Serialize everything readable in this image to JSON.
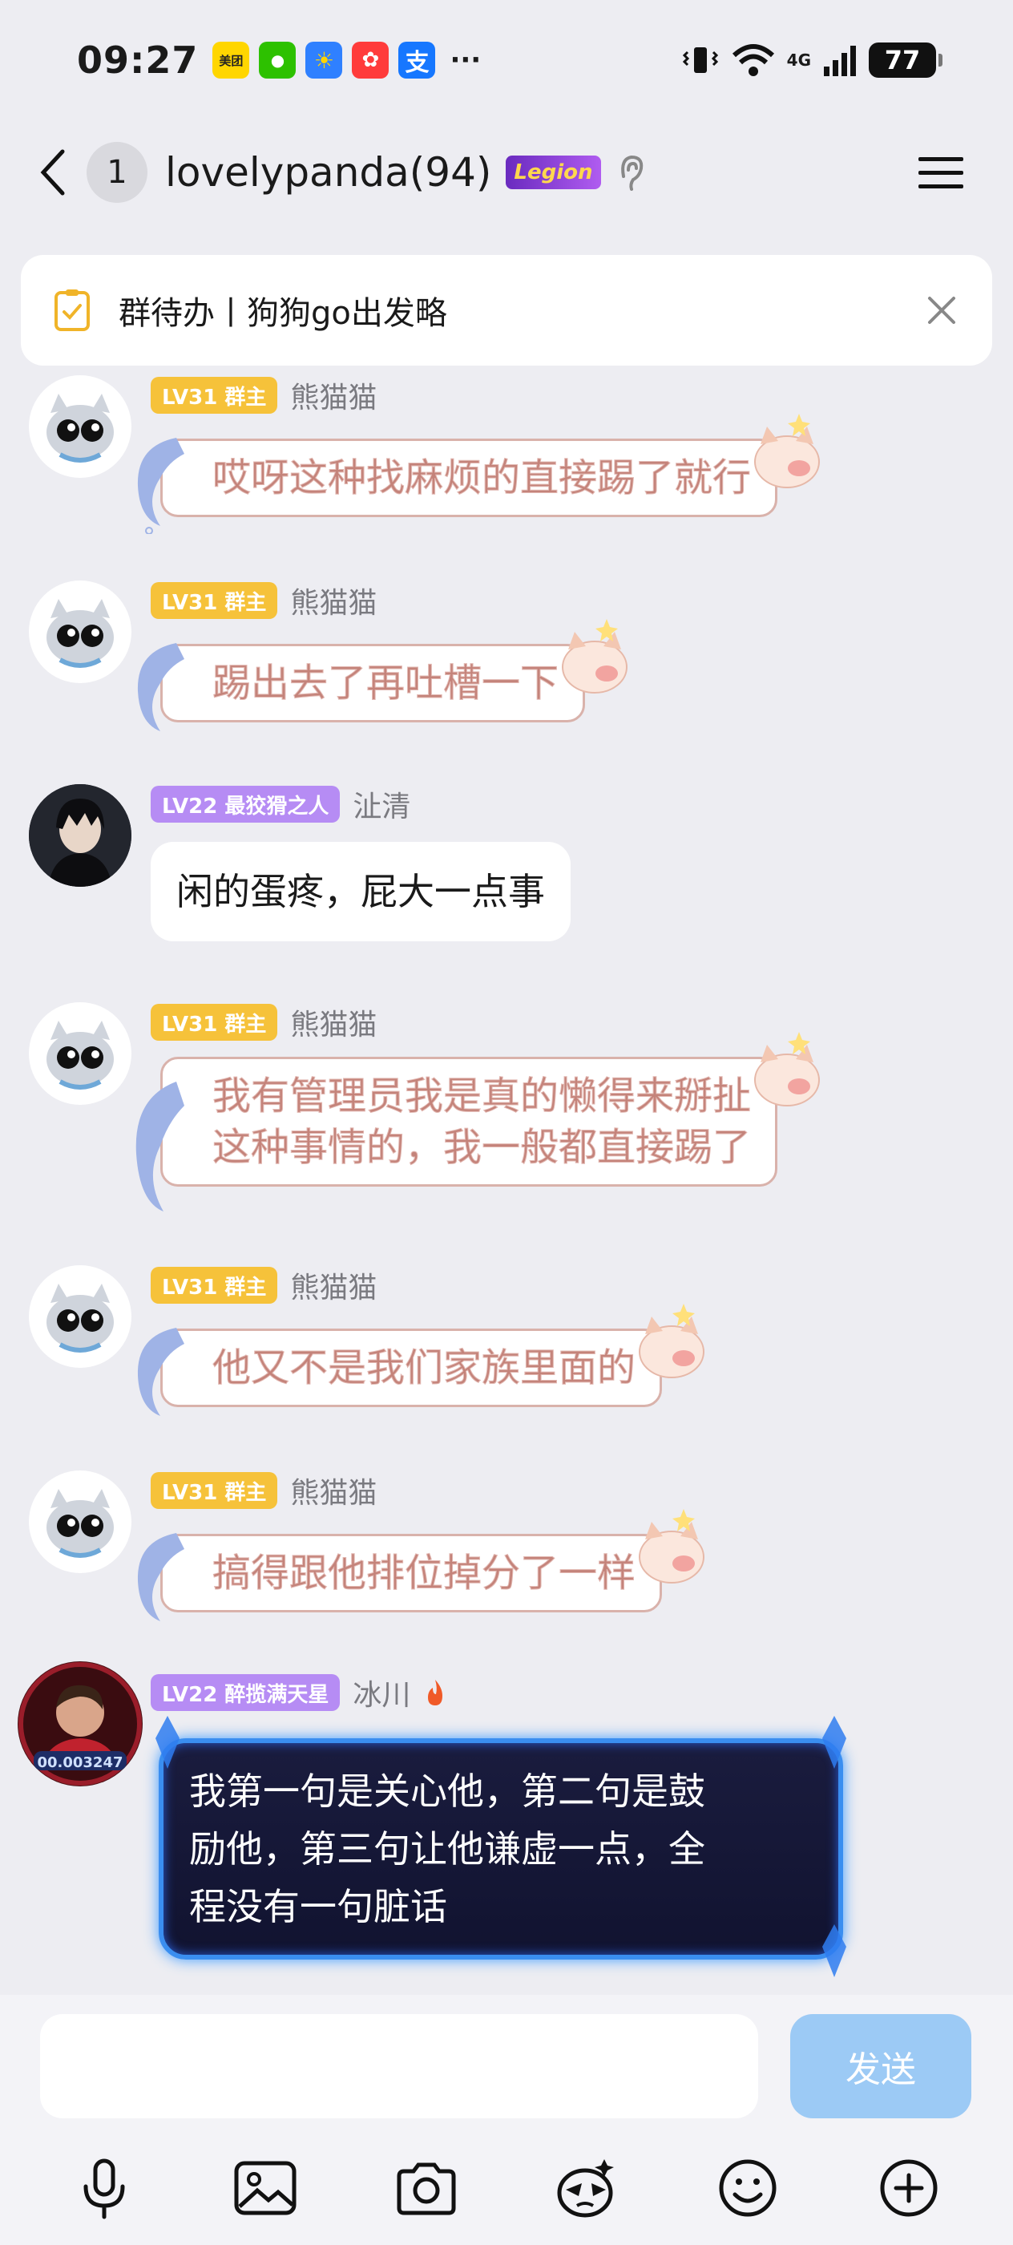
{
  "status_bar": {
    "time": "09:27",
    "notif_meituan": "美团",
    "notif_alipay": "支",
    "more": "···",
    "network": "4G",
    "battery": "77"
  },
  "nav": {
    "unread_count": "1",
    "title": "lovelypanda(94)",
    "legion_badge": "Legion"
  },
  "todo_banner": {
    "text": "群待办丨狗狗go出发略"
  },
  "messages": [
    {
      "level": "LV31 群主",
      "sender": "熊猫猫",
      "text": "哎呀这种找麻烦的直接踢了就行"
    },
    {
      "level": "LV31 群主",
      "sender": "熊猫猫",
      "text": "踢出去了再吐槽一下"
    },
    {
      "level": "LV22 最狡猾之人",
      "sender": "沚清",
      "text": "闲的蛋疼，屁大一点事"
    },
    {
      "level": "LV31 群主",
      "sender": "熊猫猫",
      "text_line1": "我有管理员我是真的懒得来掰扯",
      "text_line2": "这种事情的，我一般都直接踢了"
    },
    {
      "level": "LV31 群主",
      "sender": "熊猫猫",
      "text": "他又不是我们家族里面的"
    },
    {
      "level": "LV31 群主",
      "sender": "熊猫猫",
      "text": "搞得跟他排位掉分了一样"
    },
    {
      "level": "LV22 醉揽满天星",
      "sender": "冰川",
      "avatar_tag": "00.003247",
      "text_line1": "我第一句是关心他，第二句是鼓",
      "text_line2": "励他，第三句让他谦虚一点，全",
      "text_line3": "程没有一句脏话"
    }
  ],
  "input": {
    "placeholder": "",
    "send_label": "发送"
  },
  "colors": {
    "accent": "#9ccaf5",
    "gold_badge": "#f6c23a",
    "purple_badge": "#b68cf4"
  }
}
